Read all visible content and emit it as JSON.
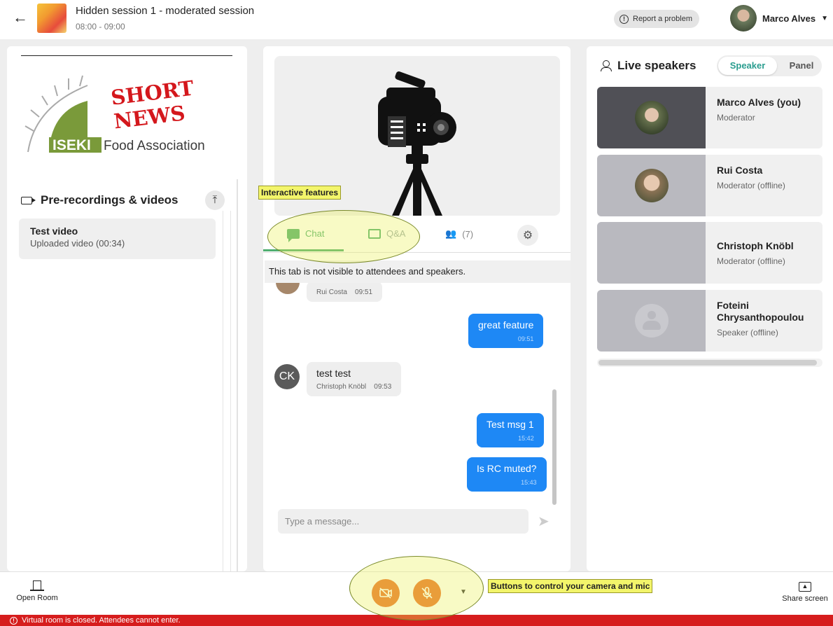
{
  "header": {
    "title": "Hidden session 1 - moderated session",
    "time": "08:00 - 09:00",
    "report_label": "Report a problem",
    "user_name": "Marco Alves"
  },
  "left_panel": {
    "logo_text": "SHORT NEWS",
    "logo_org_short": "ISEKI",
    "logo_org_rest": "Food Association",
    "section_title": "Pre-recordings & videos",
    "videos": [
      {
        "title": "Test video",
        "subtitle": "Uploaded video (00:34)"
      }
    ]
  },
  "center_panel": {
    "tabs": {
      "chat": "Chat",
      "qa": "Q&A",
      "people": "(7)"
    },
    "notice": "This tab is not visible to attendees and speakers.",
    "messages": [
      {
        "type": "in",
        "author": "Rui Costa",
        "time": "09:51",
        "text": ""
      },
      {
        "type": "out",
        "text": "great feature",
        "time": "09:51"
      },
      {
        "type": "in",
        "author": "Christoph Knöbl",
        "initials": "CK",
        "time": "09:53",
        "text": "test test"
      },
      {
        "type": "out",
        "text": "Test msg 1",
        "time": "15:42"
      },
      {
        "type": "out",
        "text": "Is RC muted?",
        "time": "15:43"
      }
    ],
    "input_placeholder": "Type a message..."
  },
  "right_panel": {
    "title": "Live speakers",
    "toggle": {
      "speaker": "Speaker",
      "panel": "Panel"
    },
    "speakers": [
      {
        "name": "Marco Alves (you)",
        "role": "Moderator"
      },
      {
        "name": "Rui Costa",
        "role": "Moderator (offline)"
      },
      {
        "name": "Christoph Knöbl",
        "role": "Moderator (offline)"
      },
      {
        "name": "Foteini Chrysanthopoulou",
        "role": "Speaker (offline)"
      }
    ]
  },
  "bottom_bar": {
    "open_room": "Open Room",
    "share_screen": "Share screen"
  },
  "banner": {
    "text": "Virtual room is closed. Attendees cannot enter."
  },
  "annotations": {
    "interactive": "Interactive features",
    "buttons": "Buttons to control your camera and mic"
  },
  "colors": {
    "accent_green": "#4fae70",
    "chat_blue": "#1e88f5",
    "control_orange": "#e8702a",
    "banner_red": "#d61d1d"
  }
}
